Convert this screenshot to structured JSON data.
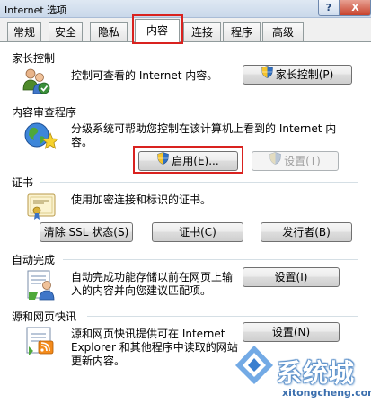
{
  "window": {
    "title": "Internet 选项",
    "help_label": "?",
    "close_label": "X"
  },
  "tabs": [
    {
      "label": "常规"
    },
    {
      "label": "安全"
    },
    {
      "label": "隐私"
    },
    {
      "label": "内容",
      "active": true
    },
    {
      "label": "连接"
    },
    {
      "label": "程序"
    },
    {
      "label": "高级"
    }
  ],
  "parental": {
    "title": "家长控制",
    "desc": "控制可查看的 Internet 内容。",
    "button": "家长控制(P)"
  },
  "advisor": {
    "title": "内容审查程序",
    "desc_line1": "分级系统可帮助您控制在该计算机上看到的 Internet 内",
    "desc_line2": "容。",
    "enable_button": "启用(E)...",
    "settings_button": "设置(T)"
  },
  "certificates": {
    "title": "证书",
    "desc": "使用加密连接和标识的证书。",
    "clear_ssl_button": "清除 SSL 状态(S)",
    "certs_button": "证书(C)",
    "publishers_button": "发行者(B)"
  },
  "autocomplete": {
    "title": "自动完成",
    "desc_line1": "自动完成功能存储以前在网页上输",
    "desc_line2": "入的内容并向您建议匹配项。",
    "settings_button": "设置(I)"
  },
  "feeds": {
    "title": "源和网页快讯",
    "desc_line1": "源和网页快讯提供可在 Internet",
    "desc_line2": "Explorer 和其他程序中读取的网站",
    "desc_line3": "更新内容。",
    "settings_button": "设置(N)"
  },
  "watermark": {
    "name": "系统城",
    "url": "xitongcheng.com"
  }
}
